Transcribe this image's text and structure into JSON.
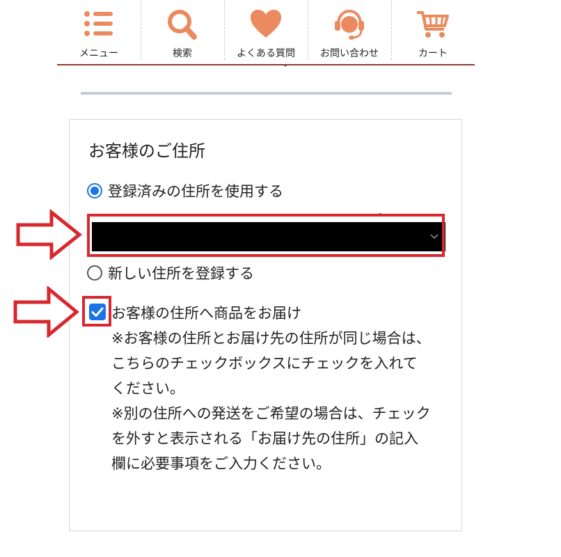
{
  "nav": {
    "items": [
      {
        "label": "メニュー",
        "icon": "menu-list-icon"
      },
      {
        "label": "検索",
        "icon": "search-icon"
      },
      {
        "label": "よくある質問",
        "icon": "heart-icon"
      },
      {
        "label": "お問い合わせ",
        "icon": "headset-support-icon"
      },
      {
        "label": "カート",
        "icon": "cart-icon"
      }
    ],
    "icon_color": "#eb8a5e"
  },
  "address": {
    "title": "お客様のご住所",
    "use_registered_label": "登録済みの住所を使用する",
    "register_new_label": "新しい住所を登録する",
    "selected_option": "use_registered",
    "deliver_to_customer_label": "お客様の住所へ商品をお届け",
    "deliver_to_customer_checked": true,
    "notes": [
      "※お客様の住所とお届け先の住所が同じ場合は、こちらのチェックボックスにチェックを入れてください。",
      "※別の住所への発送をご希望の場合は、チェックを外すと表示される「お届け先の住所」の記入欄に必要事項をご入力ください。"
    ]
  },
  "colors": {
    "accent": "#1a73e8",
    "annotation": "#d9272e",
    "nav_underline": "#8b3a3a"
  }
}
